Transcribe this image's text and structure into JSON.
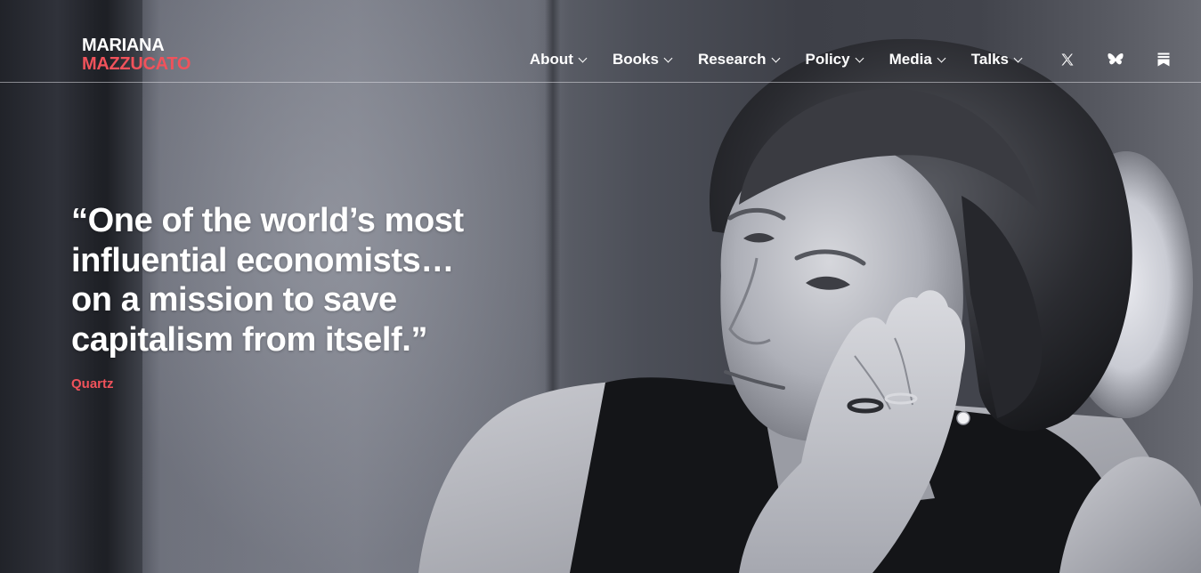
{
  "brand": {
    "first_name": "MARIANA",
    "last_name": "MAZZUCATO",
    "accent_color": "#f0525b"
  },
  "nav": {
    "items": [
      {
        "label": "About"
      },
      {
        "label": "Books"
      },
      {
        "label": "Research"
      },
      {
        "label": "Policy"
      },
      {
        "label": "Media"
      },
      {
        "label": "Talks"
      }
    ],
    "social": [
      {
        "icon": "x-icon"
      },
      {
        "icon": "bluesky-butterfly-icon"
      },
      {
        "icon": "substack-icon"
      }
    ]
  },
  "hero": {
    "quote_lines": [
      "“One of the world’s most",
      "influential economists…",
      "on a mission to save",
      "capitalism from itself.”"
    ],
    "source": "Quartz",
    "image": "black-and-white portrait photo"
  }
}
